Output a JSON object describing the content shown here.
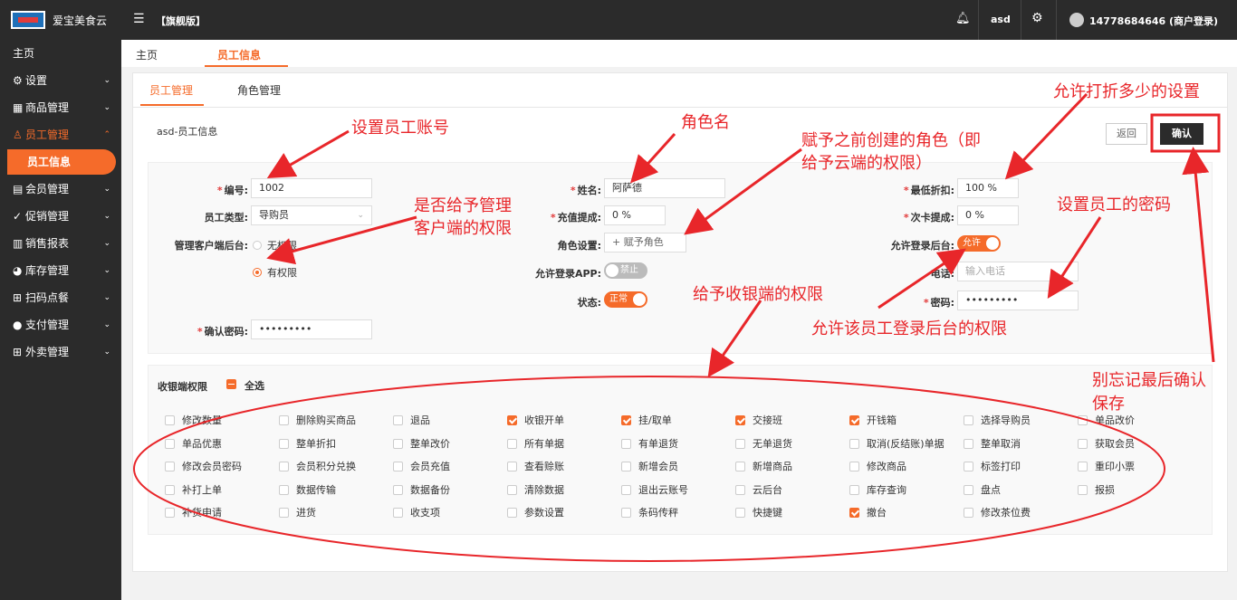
{
  "topbar": {
    "app_name": "爱宝美食云",
    "menu_icon": "hamburger-icon",
    "edition": "【旗舰版】",
    "bell_icon": "bell-icon",
    "user": "asd",
    "settings_icon": "gear-icon",
    "account": "14778684646 (商户登录)"
  },
  "sidebar": {
    "items": [
      {
        "label": "主页",
        "icon": ""
      },
      {
        "label": "设置",
        "icon": "gear-icon"
      },
      {
        "label": "商品管理",
        "icon": "grid-icon"
      },
      {
        "label": "员工管理",
        "icon": "user-icon"
      },
      {
        "label": "员工信息",
        "icon": ""
      },
      {
        "label": "会员管理",
        "icon": "member-icon"
      },
      {
        "label": "促销管理",
        "icon": "check-circle-icon"
      },
      {
        "label": "销售报表",
        "icon": "bar-chart-icon"
      },
      {
        "label": "库存管理",
        "icon": "pie-icon"
      },
      {
        "label": "扫码点餐",
        "icon": "qr-icon"
      },
      {
        "label": "支付管理",
        "icon": "coin-icon"
      },
      {
        "label": "外卖管理",
        "icon": "takeout-icon"
      }
    ]
  },
  "content_tabs": [
    "主页",
    "员工信息"
  ],
  "panel": {
    "tabs": [
      "员工管理",
      "角色管理"
    ],
    "title": "asd-员工信息",
    "back_label": "返回",
    "confirm_label": "确认"
  },
  "form": {
    "id_label": "编号:",
    "id_value": "1002",
    "type_label": "员工类型:",
    "type_value": "导购员",
    "backend_label": "管理客户端后台:",
    "backend_options": [
      "无权限",
      "有权限"
    ],
    "confirm_pwd_label": "确认密码:",
    "confirm_pwd_value": "•••••••••",
    "name_label": "姓名:",
    "name_value": "阿萨德",
    "recharge_label": "充值提成:",
    "recharge_value": "0 %",
    "role_label": "角色设置:",
    "role_button": "+ 赋予角色",
    "app_label": "允许登录APP:",
    "app_toggle": "禁止",
    "status_label": "状态:",
    "status_toggle": "正常",
    "discount_label": "最低折扣:",
    "discount_value": "100 %",
    "card_label": "次卡提成:",
    "card_value": "0 %",
    "login_backend_label": "允许登录后台:",
    "login_backend_toggle": "允许",
    "phone_label": "电话:",
    "phone_placeholder": "输入电话",
    "pwd_label": "密码:",
    "pwd_value": "•••••••••"
  },
  "permissions": {
    "title": "收银端权限",
    "select_all": "全选",
    "rows": [
      [
        {
          "label": "修改数量",
          "checked": false
        },
        {
          "label": "删除购买商品",
          "checked": false
        },
        {
          "label": "退品",
          "checked": false
        },
        {
          "label": "收银开单",
          "checked": true
        },
        {
          "label": "挂/取单",
          "checked": true
        },
        {
          "label": "交接班",
          "checked": true
        },
        {
          "label": "开钱箱",
          "checked": true
        },
        {
          "label": "选择导购员",
          "checked": false
        },
        {
          "label": "单品改价",
          "checked": false
        }
      ],
      [
        {
          "label": "单品优惠",
          "checked": false
        },
        {
          "label": "整单折扣",
          "checked": false
        },
        {
          "label": "整单改价",
          "checked": false
        },
        {
          "label": "所有单据",
          "checked": false
        },
        {
          "label": "有单退货",
          "checked": false
        },
        {
          "label": "无单退货",
          "checked": false
        },
        {
          "label": "取消(反结账)单据",
          "checked": false
        },
        {
          "label": "整单取消",
          "checked": false
        },
        {
          "label": "获取会员",
          "checked": false
        }
      ],
      [
        {
          "label": "修改会员密码",
          "checked": false
        },
        {
          "label": "会员积分兑换",
          "checked": false
        },
        {
          "label": "会员充值",
          "checked": false
        },
        {
          "label": "查看赊账",
          "checked": false
        },
        {
          "label": "新增会员",
          "checked": false
        },
        {
          "label": "新增商品",
          "checked": false
        },
        {
          "label": "修改商品",
          "checked": false
        },
        {
          "label": "标签打印",
          "checked": false
        },
        {
          "label": "重印小票",
          "checked": false
        }
      ],
      [
        {
          "label": "补打上单",
          "checked": false
        },
        {
          "label": "数据传输",
          "checked": false
        },
        {
          "label": "数据备份",
          "checked": false
        },
        {
          "label": "清除数据",
          "checked": false
        },
        {
          "label": "退出云账号",
          "checked": false
        },
        {
          "label": "云后台",
          "checked": false
        },
        {
          "label": "库存查询",
          "checked": false
        },
        {
          "label": "盘点",
          "checked": false
        },
        {
          "label": "报损",
          "checked": false
        }
      ],
      [
        {
          "label": "补货申请",
          "checked": false
        },
        {
          "label": "进货",
          "checked": false
        },
        {
          "label": "收支项",
          "checked": false
        },
        {
          "label": "参数设置",
          "checked": false
        },
        {
          "label": "条码传秤",
          "checked": false
        },
        {
          "label": "快捷键",
          "checked": false
        },
        {
          "label": "撤台",
          "checked": true
        },
        {
          "label": "修改茶位费",
          "checked": false
        }
      ]
    ]
  },
  "annotations": {
    "account": "设置员工账号",
    "role_name": "角色名",
    "assign_role_1": "赋予之前创建的角色（即",
    "assign_role_2": "给予云端的权限）",
    "discount": "允许打折多少的设置",
    "client_1": "是否给予管理",
    "client_2": "客户端的权限",
    "password": "设置员工的密码",
    "cashier": "给予收银端的权限",
    "allow_login": "允许该员工登录后台的权限",
    "save_1": "别忘记最后确认",
    "save_2": "保存"
  },
  "colors": {
    "accent": "#f56b2a",
    "annotation": "#e8262a",
    "dark": "#2b2b2b"
  }
}
